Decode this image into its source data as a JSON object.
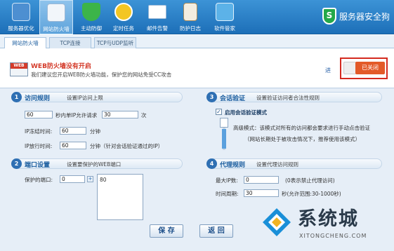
{
  "toolbar": {
    "items": [
      {
        "label": "服务器优化",
        "icon": "server-optimize-icon"
      },
      {
        "label": "网站防火墙",
        "icon": "website-firewall-icon"
      },
      {
        "label": "主动防御",
        "icon": "active-defense-icon"
      },
      {
        "label": "定时任务",
        "icon": "clock-icon"
      },
      {
        "label": "邮件告警",
        "icon": "mail-alert-icon"
      },
      {
        "label": "防护日志",
        "icon": "log-icon"
      },
      {
        "label": "软件管家",
        "icon": "software-manager-icon"
      }
    ],
    "brand": "服务器安全狗",
    "brand_letter": "S"
  },
  "subtabs": [
    "网站防火墙",
    "TCP连接",
    "TCP与UDP监听"
  ],
  "banner": {
    "icon_text": "WEB",
    "title": "WEB防火墙没有开启",
    "desc": "我们建议您开启WEB防火墙功能，保护您的网站免受CC攻击",
    "enter": "进",
    "toggle_label": "已关闭"
  },
  "sections": {
    "access": {
      "num": "1",
      "title": "访问规则",
      "sub": "设置IP访问上限",
      "seconds_value": "60",
      "seconds_label": "秒内单IP允许请求",
      "requests_value": "30",
      "requests_unit": "次",
      "freeze_label": "IP冻结时间:",
      "freeze_value": "60",
      "freeze_unit": "分钟",
      "release_label": "IP放行时间:",
      "release_value": "60",
      "release_unit": "分钟（针对会话验证通过的IP）"
    },
    "session": {
      "num": "3",
      "title": "会话验证",
      "sub": "设置验证访问者合法性规则",
      "enable_label": "启用会话验证模式",
      "enabled": true,
      "mode_text": "高级模式：该模式对所有的访问都会要求进行手动点击验证",
      "mode_note": "（网站长期处于被攻击情况下，推荐使用该模式）"
    },
    "port": {
      "num": "2",
      "title": "端口设置",
      "sub": "设置要保护的WEB端口",
      "label": "保护的端口:",
      "value": "0",
      "list": [
        "80"
      ]
    },
    "proxy": {
      "num": "4",
      "title": "代理规则",
      "sub": "设置代理访问规则",
      "max_ip_label": "最大IP数:",
      "max_ip_value": "0",
      "max_ip_note": "(0表示禁止代理访问)",
      "period_label": "时间周期:",
      "period_value": "30",
      "period_note": "秒(允许范围:30-1000秒)"
    }
  },
  "buttons": {
    "save": "保 存",
    "back": "返 回"
  },
  "watermark": {
    "text": "系统城",
    "url": "XITONGCHENG.COM"
  }
}
